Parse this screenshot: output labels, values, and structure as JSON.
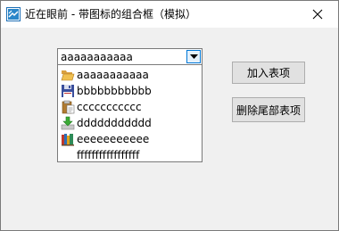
{
  "window": {
    "title": "近在眼前 - 带图标的组合框（模拟）"
  },
  "combo": {
    "selected_value": "aaaaaaaaaaa"
  },
  "dropdown": {
    "items": [
      {
        "label": "aaaaaaaaaaa",
        "icon": "open-folder-icon"
      },
      {
        "label": "bbbbbbbbbbb",
        "icon": "floppy-disk-icon"
      },
      {
        "label": "ccccccccccc",
        "icon": "clipboard-paste-icon"
      },
      {
        "label": "ddddddddddd",
        "icon": "download-arrow-icon"
      },
      {
        "label": "eeeeeeeeeee",
        "icon": "library-books-icon"
      },
      {
        "label": "fffffffffffffffff",
        "icon": ""
      }
    ]
  },
  "buttons": {
    "add_item": "加入表项",
    "delete_last": "删除尾部表项"
  },
  "colors": {
    "window_bg": "#f0f0f0",
    "titlebar_bg": "#ffffff",
    "focus_accent": "#0078d7",
    "button_bg": "#e1e1e1"
  }
}
